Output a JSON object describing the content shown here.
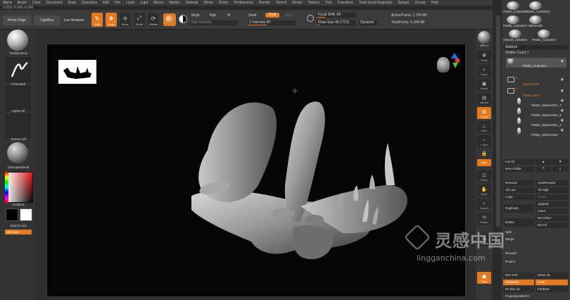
{
  "menu": [
    "Alpha",
    "Brush",
    "Color",
    "Document",
    "Draw",
    "Dynamics",
    "Edit",
    "File",
    "Layer",
    "Light",
    "Macro",
    "Marker",
    "Material",
    "Movie",
    "Picker",
    "Preferences",
    "Render",
    "Stencil",
    "Stroke",
    "Texture",
    "Tool",
    "Transform",
    "Tools Used Regularly",
    "Zplugin",
    "Zscript",
    "Help"
  ],
  "coords": "0.553,-0.249,-0.242",
  "topbar": {
    "home_page": "Home Page",
    "lightbox": "LightBox",
    "live_boolean": "Live Boolean",
    "edit": "Edit",
    "draw": "Draw",
    "move": "Move",
    "scale": "Scale",
    "rotate": "Rotate",
    "mrgb": "Mrgb",
    "rgb": "Rgb",
    "m": "M",
    "zadd": "Zadd",
    "zsub": "Zsub",
    "zcut": "Zcut",
    "rgb_intensity": "Rgb Intensity",
    "z_intensity": "Z Intensity 43",
    "focal_shift": "Focal Shift -56",
    "draw_size": "Draw Size 46.17211",
    "dynamic": "Dynamic",
    "active_points": "ActivePoints: 1.754 Mil",
    "total_points": "TotalPoints: 6.395 Mil"
  },
  "left": {
    "brush_name": "TrimDynamic",
    "stroke_name": "FreeHand",
    "alpha": "Alpha Off",
    "texture": "Texture Off",
    "material": "StartupMaterial",
    "gradient": "Gradient",
    "switch_color": "SwitchColor",
    "alternate": "Alternate"
  },
  "rightshelf": {
    "spix": "SPix 3",
    "buttons": [
      {
        "label": "BPR",
        "icon": "sphere-icon"
      },
      {
        "label": "Scroll",
        "icon": "scroll-icon"
      },
      {
        "label": "Zoom",
        "icon": "zoom-icon"
      },
      {
        "label": "Actual",
        "icon": "actual-icon"
      },
      {
        "label": "AAHalf",
        "icon": "aahalf-icon"
      },
      {
        "label": "Persp",
        "icon": "persp-icon"
      },
      {
        "label": "Floor",
        "icon": "floor-icon"
      },
      {
        "label": "L.Sym",
        "icon": "lsym-icon"
      },
      {
        "label": "Gxyz",
        "icon": "gxyz-icon"
      },
      {
        "label": "Frame",
        "icon": "frame-icon"
      },
      {
        "label": "Move",
        "icon": "move-icon"
      },
      {
        "label": "ZoomD",
        "icon": "zoomd-icon"
      },
      {
        "label": "Rotate",
        "icon": "rotate-icon"
      },
      {
        "label": "Transp",
        "icon": "transp-icon"
      },
      {
        "label": "Solo",
        "icon": "solo-icon"
      }
    ]
  },
  "rightpanel": {
    "tools": [
      {
        "name": "PM3D_Cube3D4",
        "count": "2"
      },
      {
        "name": "PM3D_Cylinder3",
        "count": "3"
      },
      {
        "name": "PM3D_Cylinder3",
        "count": "2"
      },
      {
        "name": "Sphere3D",
        "count": ""
      },
      {
        "name": "UMesh_Cilinders",
        "count": "2"
      },
      {
        "name": "PM3D_Cube3D3",
        "count": ""
      }
    ],
    "subtool_title": "Subtool",
    "visible_count": "Visible Count 7",
    "subtools": [
      {
        "name": "PM3D_Cube3D4",
        "kind": "mesh",
        "num": "",
        "orange": false
      },
      {
        "name": "UpperTeeth",
        "kind": "folder",
        "num": "6",
        "orange": true
      },
      {
        "name": "TeethLower",
        "kind": "folder",
        "num": "7",
        "orange": true
      },
      {
        "name": "PM3D_Sphere3D1_7",
        "kind": "tooth",
        "num": "",
        "orange": false
      },
      {
        "name": "PM3D_Sphere3D1_8",
        "kind": "tooth",
        "num": "",
        "orange": false
      },
      {
        "name": "PM3D_Sphere3D1_2",
        "kind": "tooth",
        "num": "",
        "orange": false
      },
      {
        "name": "PM3D_Sphere3D2",
        "kind": "tooth",
        "num": "",
        "orange": false
      }
    ],
    "buttons": {
      "list_all": "List All",
      "new_folder": "New Folder",
      "rename": "Rename",
      "autoreorder": "AutoReorder",
      "all_low": "All Low",
      "all_high": "All High",
      "copy": "Copy",
      "paste": "Paste",
      "append": "Append",
      "duplicate": "Duplicate",
      "insert": "Insert",
      "delete": "Delete",
      "del_other": "Del Other",
      "del_all": "Del All",
      "split": "Split",
      "merge": "Merge",
      "remesh": "Remesh",
      "project": "Project",
      "dist": "Dist 0.02",
      "mean": "Mean 25",
      "geometry": "Geometry",
      "color": "Color",
      "pa_blur": "PA Blur 10",
      "farthest": "Farthest",
      "projection_shell": "ProjectionShell 0"
    }
  },
  "watermark": {
    "title": "灵感中国",
    "url": "lingganchina.com"
  },
  "colors": {
    "accent": "#e37a1f"
  }
}
